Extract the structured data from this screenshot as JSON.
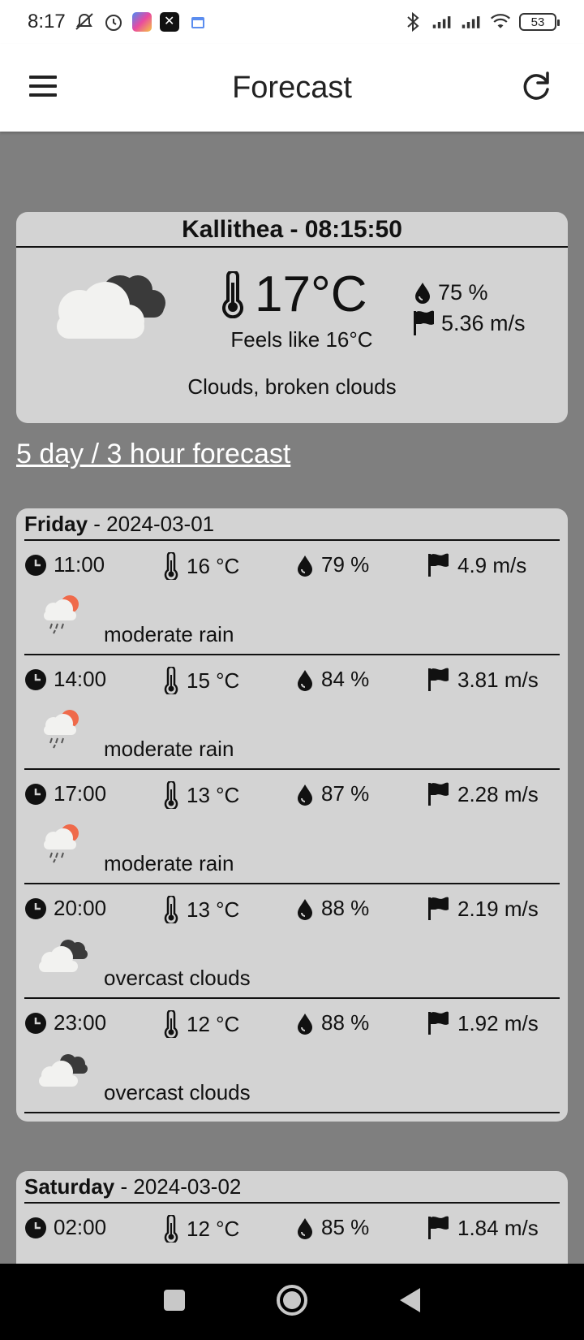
{
  "status_bar": {
    "time": "8:17",
    "battery": "53",
    "icons": [
      "mute-icon",
      "alarm-icon",
      "app-icon",
      "x-icon",
      "calendar-icon",
      "bluetooth-icon",
      "signal-icon",
      "signal-icon",
      "wifi-icon",
      "battery-icon"
    ]
  },
  "app_bar": {
    "title": "Forecast",
    "menu_icon": "hamburger-menu-icon",
    "refresh_icon": "refresh-icon"
  },
  "current": {
    "location_line": "Kallithea - 08:15:50",
    "temperature": "17°C",
    "feels_like": "Feels like 16°C",
    "humidity": "75 %",
    "wind": "5.36 m/s",
    "description": "Clouds, broken clouds",
    "icon": "broken-clouds-icon"
  },
  "forecast_link": "5 day / 3 hour forecast",
  "days": [
    {
      "day": "Friday",
      "date": " - 2024-03-01",
      "slots": [
        {
          "time": "11:00",
          "temp": "16 °C",
          "humidity": "79 %",
          "wind": "4.9 m/s",
          "desc": "moderate rain",
          "icon": "rain-icon"
        },
        {
          "time": "14:00",
          "temp": "15 °C",
          "humidity": "84 %",
          "wind": "3.81 m/s",
          "desc": "moderate rain",
          "icon": "rain-icon"
        },
        {
          "time": "17:00",
          "temp": "13 °C",
          "humidity": "87 %",
          "wind": "2.28 m/s",
          "desc": "moderate rain",
          "icon": "rain-icon"
        },
        {
          "time": "20:00",
          "temp": "13 °C",
          "humidity": "88 %",
          "wind": "2.19 m/s",
          "desc": "overcast clouds",
          "icon": "overcast-clouds-icon"
        },
        {
          "time": "23:00",
          "temp": "12 °C",
          "humidity": "88 %",
          "wind": "1.92 m/s",
          "desc": "overcast clouds",
          "icon": "overcast-clouds-icon"
        }
      ]
    },
    {
      "day": "Saturday",
      "date": " - 2024-03-02",
      "slots": [
        {
          "time": "02:00",
          "temp": "12 °C",
          "humidity": "85 %",
          "wind": "1.84 m/s",
          "desc": "",
          "icon": ""
        }
      ]
    }
  ],
  "colors": {
    "background": "#7f7f7f",
    "card": "#d3d3d3",
    "sun_accent": "#ef6a4a"
  }
}
